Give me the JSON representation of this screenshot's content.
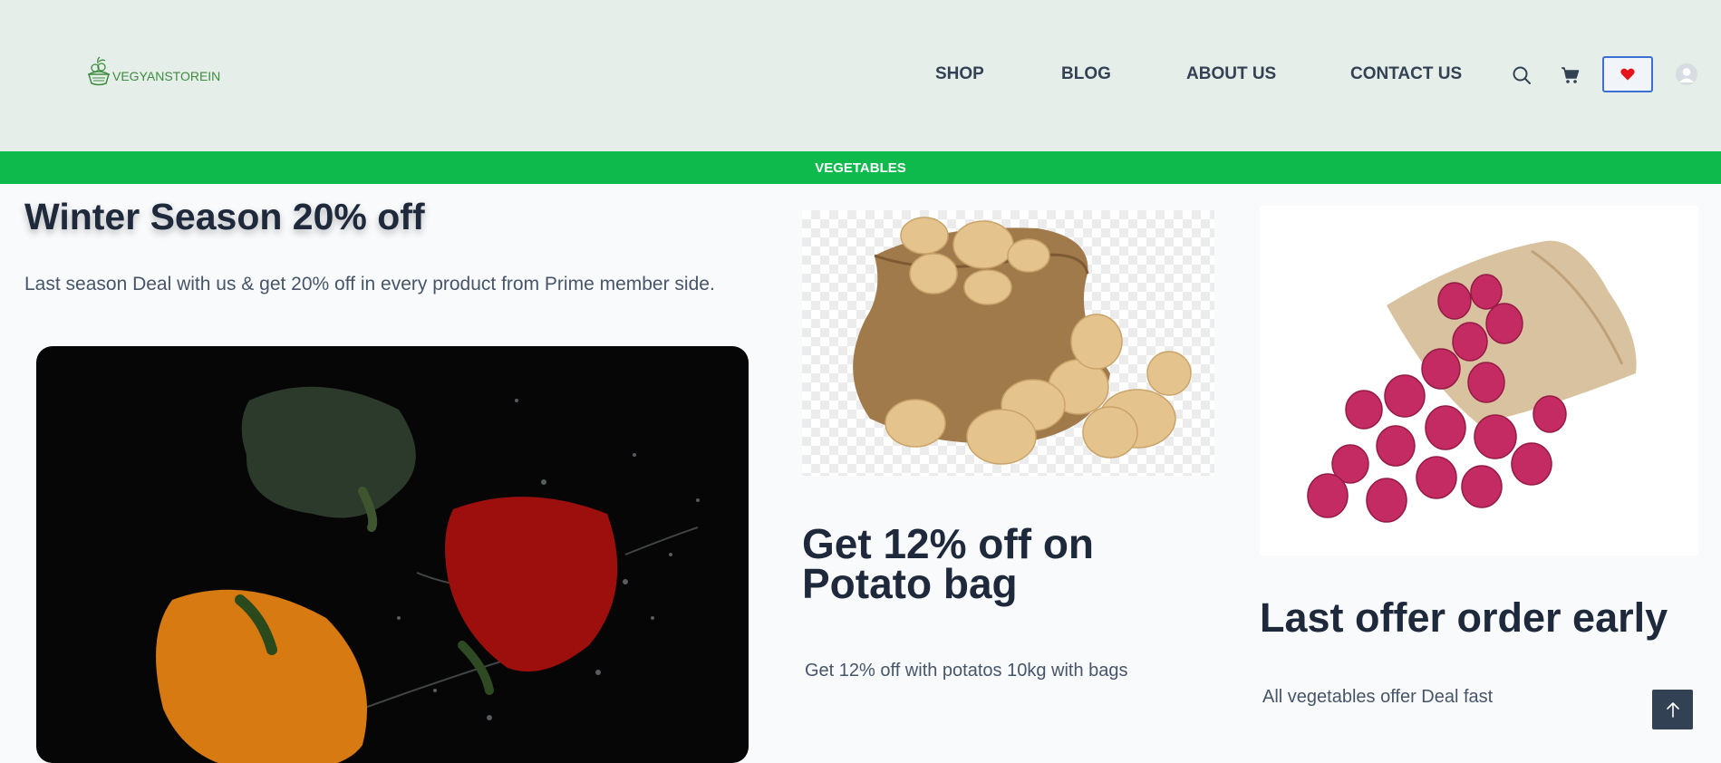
{
  "header": {
    "logo_text": "VEGYANSTOREIN",
    "nav": [
      "SHOP",
      "BLOG",
      "ABOUT US",
      "CONTACT US"
    ],
    "icons": [
      "search-icon",
      "cart-icon",
      "heart-icon",
      "user-icon"
    ]
  },
  "banner": {
    "label": "VEGETABLES"
  },
  "promo_winter": {
    "title": "Winter Season 20% off",
    "text": "Last season Deal with us  & get 20% off in every product from Prime member side."
  },
  "promo_potato": {
    "title": "Get 12% off on Potato bag",
    "text": "Get 12% off with potatos 10kg with bags"
  },
  "promo_onion": {
    "title": "Last offer order early",
    "text": "All vegetables offer Deal fast"
  },
  "colors": {
    "header_bg": "#e5eee8",
    "banner": "#0dba4b",
    "heading": "#1e293b",
    "heart": "#e5141b",
    "logo": "#3d8c3f"
  }
}
